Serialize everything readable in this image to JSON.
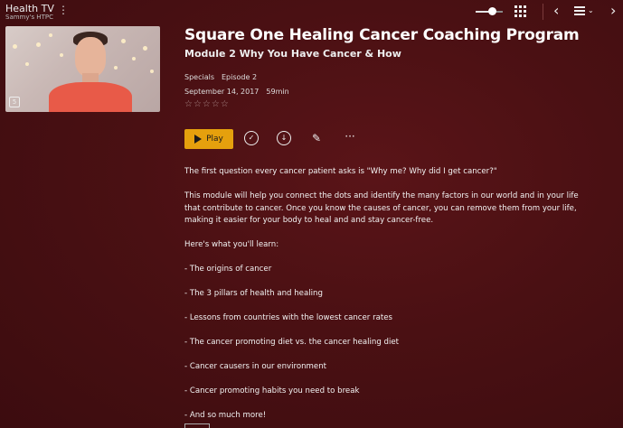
{
  "header": {
    "library": "Health TV",
    "server": "Sammy's HTPC"
  },
  "toolbar": {
    "slider_value": 0.6
  },
  "item": {
    "title": "Square One Healing Cancer Coaching Program",
    "subtitle": "Module 2 Why You Have Cancer & How",
    "season": "Specials",
    "episode": "Episode 2",
    "date": "September 14, 2017",
    "duration": "59min",
    "rating_stars": "☆☆☆☆☆"
  },
  "actions": {
    "play_label": "Play"
  },
  "description": [
    "The first question every cancer patient asks is \"Why me? Why did I get cancer?\"",
    "This module will help you connect the dots and identify the many factors in our world and in your life that contribute to cancer. Once you know the causes of cancer, you can remove them from your life, making it easier for your body to heal and and stay cancer-free.",
    "Here's what you'll learn:",
    "- The origins of cancer",
    "- The 3 pillars of health and healing",
    "- Lessons from countries with the lowest cancer rates",
    "- The cancer promoting diet vs. the cancer healing diet",
    "- Cancer causers in our environment",
    "- Cancer promoting habits you need to break",
    "- And so much more!"
  ],
  "colors": {
    "background": "#4a1013",
    "accent": "#e5a00d"
  },
  "icons": [
    "kebab-menu-icon",
    "grid-icon",
    "back-icon",
    "list-icon",
    "forward-icon",
    "check-circle-icon",
    "download-icon",
    "pencil-icon",
    "more-icon",
    "play-icon"
  ]
}
